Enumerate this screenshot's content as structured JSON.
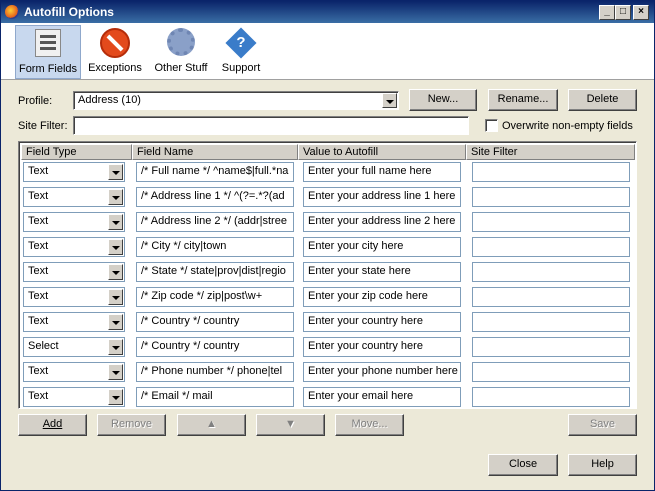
{
  "window": {
    "title": "Autofill Options"
  },
  "toolbar": {
    "items": [
      {
        "label": "Form Fields",
        "icon": "form-fields-icon",
        "active": true
      },
      {
        "label": "Exceptions",
        "icon": "exceptions-icon"
      },
      {
        "label": "Other Stuff",
        "icon": "gear-icon"
      },
      {
        "label": "Support",
        "icon": "help-icon"
      }
    ]
  },
  "profile": {
    "label": "Profile:",
    "value": "Address (10)",
    "new_label": "New...",
    "rename_label": "Rename...",
    "delete_label": "Delete"
  },
  "site_filter": {
    "label": "Site Filter:",
    "value": ""
  },
  "overwrite": {
    "label": "Overwrite non-empty fields",
    "checked": false
  },
  "table": {
    "headers": [
      "Field Type",
      "Field Name",
      "Value to Autofill",
      "Site Filter"
    ],
    "rows": [
      {
        "type": "Text",
        "name": "/* Full name */ ^name$|full.*na",
        "value": "Enter your full name here",
        "filter": ""
      },
      {
        "type": "Text",
        "name": "/* Address line 1 */ ^(?=.*?(ad",
        "value": "Enter your address line 1 here",
        "filter": ""
      },
      {
        "type": "Text",
        "name": "/* Address line 2 */ (addr|stree",
        "value": "Enter your address line 2 here",
        "filter": ""
      },
      {
        "type": "Text",
        "name": "/* City */ city|town",
        "value": "Enter your city here",
        "filter": ""
      },
      {
        "type": "Text",
        "name": "/* State */ state|prov|dist|regio",
        "value": "Enter your state here",
        "filter": ""
      },
      {
        "type": "Text",
        "name": "/* Zip code */ zip|post\\w+",
        "value": "Enter your zip code here",
        "filter": ""
      },
      {
        "type": "Text",
        "name": "/* Country */ country",
        "value": "Enter your country here",
        "filter": ""
      },
      {
        "type": "Select",
        "name": "/* Country */ country",
        "value": "Enter your country here",
        "filter": ""
      },
      {
        "type": "Text",
        "name": "/* Phone number */ phone|tel",
        "value": "Enter your phone number here",
        "filter": ""
      },
      {
        "type": "Text",
        "name": "/* Email */ mail",
        "value": "Enter your email here",
        "filter": ""
      }
    ]
  },
  "actions": {
    "add": "Add",
    "remove": "Remove",
    "up": "▲",
    "down": "▼",
    "move": "Move...",
    "save": "Save"
  },
  "footer": {
    "close": "Close",
    "help": "Help"
  }
}
